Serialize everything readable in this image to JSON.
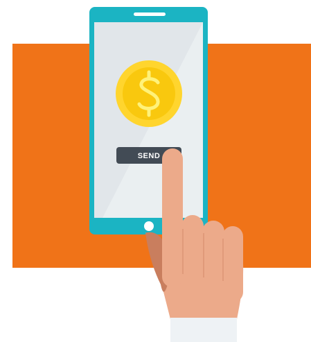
{
  "send_button": {
    "label": "SEND"
  },
  "icons": {
    "coin": "dollar-coin-icon",
    "hand": "pointing-hand-icon",
    "phone": "smartphone-icon"
  },
  "colors": {
    "background_block": "#F07318",
    "phone_frame": "#1BB4C3",
    "phone_screen": "#E1E6EA",
    "coin_outer": "#FFD52E",
    "coin_inner": "#F9C80E",
    "send_button": "#424B55",
    "send_text": "#FFFFFF",
    "skin": "#ECAA8A",
    "skin_shadow": "#C97E5E",
    "cuff": "#EEF2F5"
  }
}
